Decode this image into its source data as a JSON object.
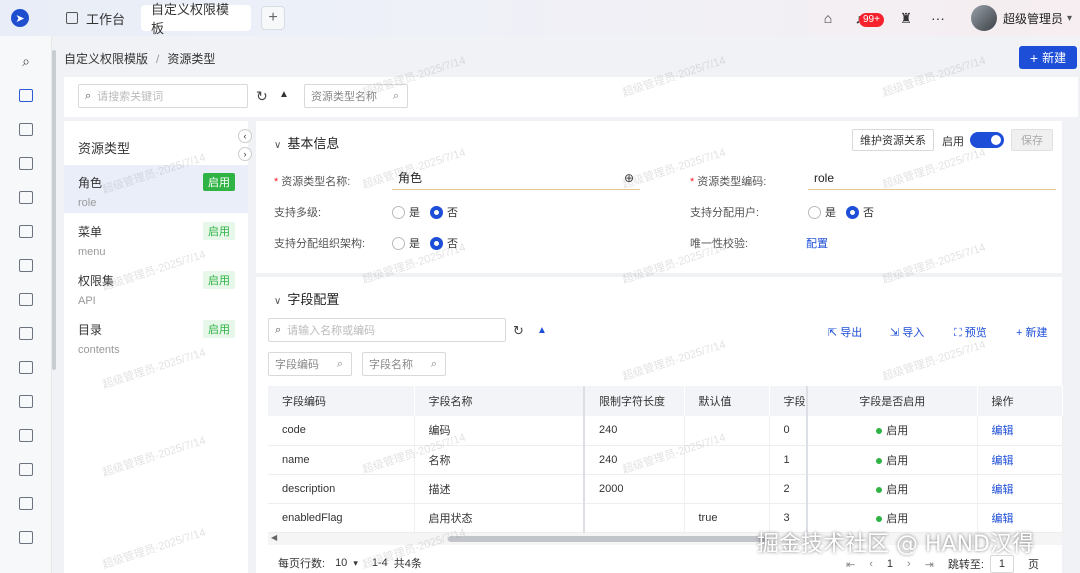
{
  "topbar": {
    "home_tab": "工作台",
    "active_tab": "自定义权限模板",
    "notif_badge": "99+",
    "username": "超级管理员"
  },
  "breadcrumb": {
    "parent": "自定义权限模版",
    "current": "资源类型"
  },
  "header": {
    "new_label": "新建"
  },
  "search_strip": {
    "placeholder": "请搜索关键词",
    "filter_label": "资源类型名称"
  },
  "resource_list": {
    "title": "资源类型",
    "items": [
      {
        "name": "角色",
        "code": "role",
        "status": "启用"
      },
      {
        "name": "菜单",
        "code": "menu",
        "status": "启用"
      },
      {
        "name": "权限集",
        "code": "API",
        "status": "启用"
      },
      {
        "name": "目录",
        "code": "contents",
        "status": "启用"
      }
    ]
  },
  "basic_info": {
    "title": "基本信息",
    "maintain_label": "维护资源关系",
    "enable_label": "启用",
    "save_label": "保存",
    "name_label": "资源类型名称:",
    "name_value": "角色",
    "code_label": "资源类型编码:",
    "code_value": "role",
    "multi_label": "支持多级:",
    "assign_user_label": "支持分配用户:",
    "assign_org_label": "支持分配组织架构:",
    "unique_label": "唯一性校验:",
    "unique_link": "配置",
    "yes": "是",
    "no": "否"
  },
  "field_config": {
    "title": "字段配置",
    "search_placeholder": "请输入名称或编码",
    "export_label": "导出",
    "import_label": "导入",
    "preview_label": "预览",
    "new_label": "新建",
    "filter_code": "字段编码",
    "filter_name": "字段名称",
    "columns": [
      "字段编码",
      "字段名称",
      "限制字符长度",
      "默认值",
      "字段",
      "字段是否启用",
      "操作"
    ],
    "rows": [
      {
        "code": "code",
        "name": "编码",
        "length": "240",
        "default": "",
        "order": "0",
        "enabled": "启用",
        "action": "编辑"
      },
      {
        "code": "name",
        "name": "名称",
        "length": "240",
        "default": "",
        "order": "1",
        "enabled": "启用",
        "action": "编辑"
      },
      {
        "code": "description",
        "name": "描述",
        "length": "2000",
        "default": "",
        "order": "2",
        "enabled": "启用",
        "action": "编辑"
      },
      {
        "code": "enabledFlag",
        "name": "启用状态",
        "length": "",
        "default": "true",
        "order": "3",
        "enabled": "启用",
        "action": "编辑"
      }
    ]
  },
  "pagination": {
    "rows_per_page_label": "每页行数:",
    "page_size": "10",
    "range": "1-4",
    "total": "共4条",
    "current_page": "1",
    "jump_label": "跳转至:",
    "jump_value": "1",
    "page_unit": "页"
  },
  "watermark_text": "超级管理员-2025/7/14",
  "corner_watermark": "掘金技术社区 @ HAND汉得",
  "colors": {
    "primary": "#1d4ed8",
    "success": "#2fb344",
    "danger": "#f5222d"
  }
}
